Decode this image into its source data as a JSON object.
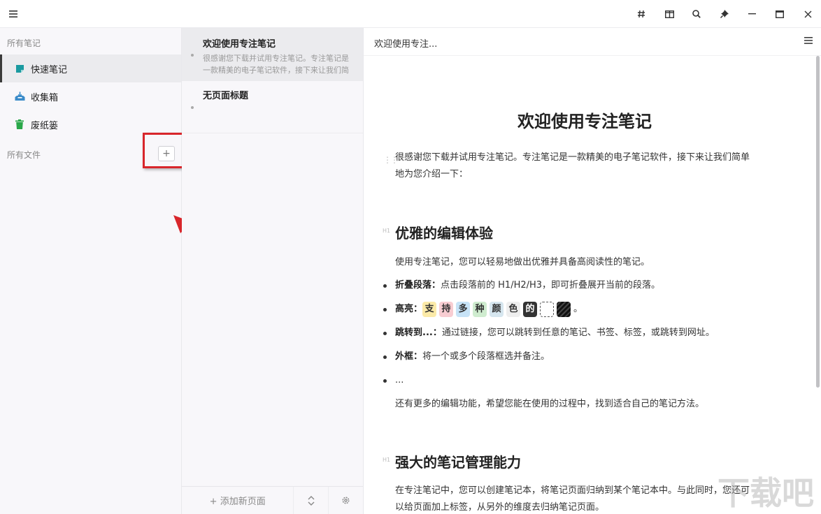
{
  "sidebar": {
    "all_notes_label": "所有笔记",
    "items": [
      {
        "label": "快速笔记",
        "icon": "quick-note-icon",
        "color": "#1a9aa0"
      },
      {
        "label": "收集箱",
        "icon": "inbox-icon",
        "color": "#3a8bc9"
      },
      {
        "label": "废纸篓",
        "icon": "trash-icon",
        "color": "#2aa84a"
      }
    ],
    "all_files_label": "所有文件",
    "add_folder_label": "+"
  },
  "notes": [
    {
      "title": "欢迎使用专注笔记",
      "snippet": "很感谢您下载并试用专注笔记。专注笔记是一款精美的电子笔记软件，接下来让我们简单…"
    },
    {
      "title": "无页面标题",
      "snippet": ""
    }
  ],
  "notes_footer": {
    "add_page_label": "+ 添加新页面"
  },
  "editor": {
    "breadcrumb": "欢迎使用专注...",
    "title": "欢迎使用专注笔记",
    "intro_line1": "很感谢您下载并试用专注笔记。专注笔记是一款精美的电子笔记软件，接下来让我们简单",
    "intro_line2": "地为您介绍一下：",
    "section1_heading": "优雅的编辑体验",
    "section1_tag": "H1",
    "section1_intro": "使用专注笔记，您可以轻易地做出优雅并具备高阅读性的笔记。",
    "list": [
      {
        "bold": "折叠段落：",
        "text": "点击段落前的 H1/H2/H3，即可折叠展开当前的段落。"
      },
      {
        "bold": "高亮：",
        "text": ""
      },
      {
        "bold": "跳转到...：",
        "text": "通过链接，您可以跳转到任意的笔记、书签、标签，或跳转到网址。"
      },
      {
        "bold": "外框：",
        "text": "将一个或多个段落框选并备注。"
      },
      {
        "bold": "",
        "text": "..."
      }
    ],
    "highlight_chars": [
      {
        "char": "支",
        "bg": "#fbeaa8",
        "fg": "#333"
      },
      {
        "char": "持",
        "bg": "#f8cdd2",
        "fg": "#333"
      },
      {
        "char": "多",
        "bg": "#c7e3f7",
        "fg": "#333"
      },
      {
        "char": "种",
        "bg": "#cfeccf",
        "fg": "#333"
      },
      {
        "char": "颜",
        "bg": "#d6e6ef",
        "fg": "#333"
      },
      {
        "char": "色",
        "bg": "#eeeeee",
        "fg": "#333"
      },
      {
        "char": "的",
        "bg": "#333333",
        "fg": "#fff"
      }
    ],
    "highlight_end": "。",
    "section1_outro": "还有更多的编辑功能，希望您能在使用的过程中，找到适合自己的笔记方法。",
    "section2_heading": "强大的笔记管理能力",
    "section2_tag": "H1",
    "section2_line1": "在专注笔记中，您可以创建笔记本，将笔记页面归纳到某个笔记本中。与此同时，您还可",
    "section2_line2": "以给页面加上标签，从另外的维度去归纳笔记页面。"
  },
  "watermark": "下载吧"
}
